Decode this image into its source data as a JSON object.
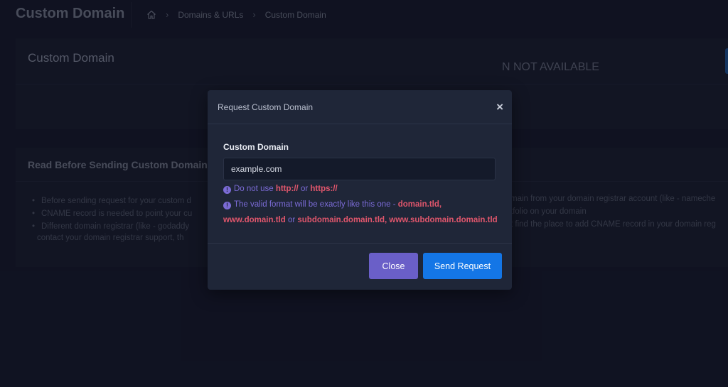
{
  "header": {
    "title": "Custom Domain",
    "breadcrumb": {
      "item1": "Domains & URLs",
      "item2": "Custom Domain"
    }
  },
  "card1": {
    "title": "Custom Domain",
    "status_text": "N NOT AVAILABLE"
  },
  "card2": {
    "title": "Read Before Sending Custom Domain Re",
    "bullets": [
      "Before sending request for your custom d",
      "CNAME record is needed to point your cu",
      "Different domain registrar (like - godaddy"
    ],
    "continuation": "contact your domain registrar support, th",
    "right_fragments": [
      "main from your domain registrar account (like - nameche",
      "tfolio on your domain",
      "t find the place to add CNAME record in your domain reg"
    ]
  },
  "modal": {
    "title": "Request Custom Domain",
    "close_icon": "×",
    "field_label": "Custom Domain",
    "field_placeholder": "example.com",
    "hint1": {
      "prefix": "Do not use ",
      "http": "http://",
      "or": " or ",
      "https": "https://"
    },
    "hint2": {
      "prefix": "The valid format will be exactly like this one - ",
      "example1": "domain.tld,"
    },
    "hint3": {
      "example2": "www.domain.tld",
      "or": " or ",
      "example3": "subdomain.domain.tld, www.subdomain.domain.tld"
    },
    "close_button": "Close",
    "send_button": "Send Request"
  },
  "colors": {
    "background": "#14182a",
    "modal": "#1f2638",
    "accent_purple": "#6a5fc8",
    "accent_blue": "#1476e6",
    "hint_text": "#7b6bd6",
    "hint_highlight": "#e0566c"
  },
  "icons": {
    "home": "home-icon",
    "info": "info-icon",
    "chevron": "chevron-right-icon",
    "close": "close-icon"
  }
}
